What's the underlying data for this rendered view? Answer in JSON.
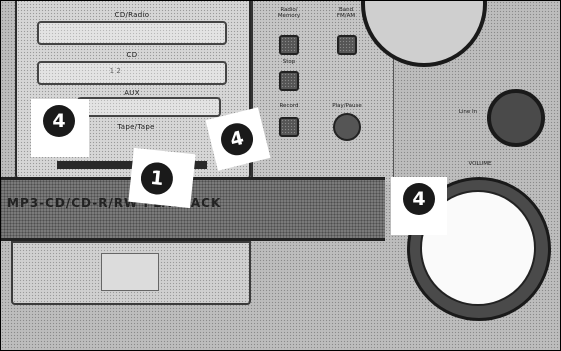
{
  "left_panel": {
    "label_top": "CD/Radio",
    "label_mid": "CD",
    "label_lower": "AUX",
    "label_bottom": "Tape/Tape"
  },
  "mid_panel": {
    "btn1_label": "Radio/ Memory",
    "btn2_label": "Band FM/AM",
    "btn3_label": "Stop",
    "btn4_label": "Record",
    "btn5_label": "Play/Pause"
  },
  "right_panel": {
    "jack_label": "Line In",
    "dial_label": "VOLUME"
  },
  "strip": {
    "text": "MP3-CD/CD-R/RW PLAYBACK"
  },
  "callouts": [
    {
      "number": "4"
    },
    {
      "number": "4"
    },
    {
      "number": "1"
    },
    {
      "number": "4"
    }
  ]
}
